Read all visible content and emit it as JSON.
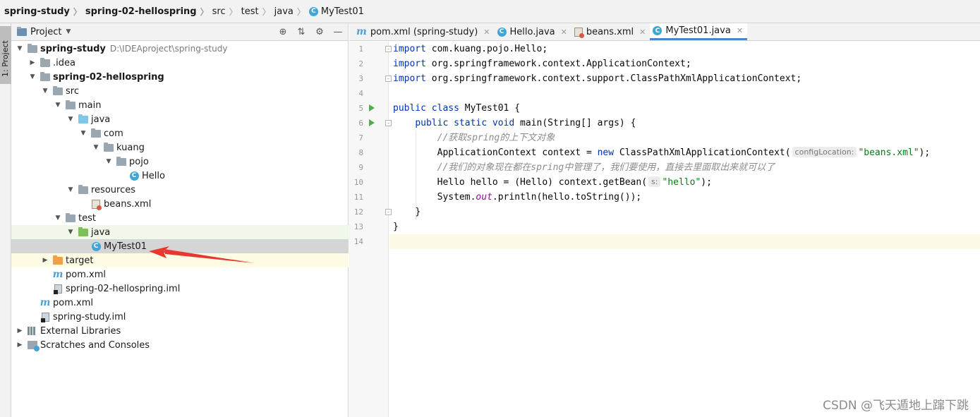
{
  "breadcrumb": [
    "spring-study",
    "spring-02-hellospring",
    "src",
    "test",
    "java",
    "MyTest01"
  ],
  "tool_strip": {
    "project_tab": "1: Project"
  },
  "project_panel": {
    "title": "Project",
    "tree": [
      {
        "label": "spring-study",
        "path": "D:\\IDEAproject\\spring-study",
        "bold": true
      },
      {
        "label": ".idea"
      },
      {
        "label": "spring-02-hellospring",
        "bold": true
      },
      {
        "label": "src"
      },
      {
        "label": "main"
      },
      {
        "label": "java"
      },
      {
        "label": "com"
      },
      {
        "label": "kuang"
      },
      {
        "label": "pojo"
      },
      {
        "label": "Hello"
      },
      {
        "label": "resources"
      },
      {
        "label": "beans.xml"
      },
      {
        "label": "test"
      },
      {
        "label": "java"
      },
      {
        "label": "MyTest01"
      },
      {
        "label": "target"
      },
      {
        "label": "pom.xml"
      },
      {
        "label": "spring-02-hellospring.iml"
      },
      {
        "label": "pom.xml"
      },
      {
        "label": "spring-study.iml"
      },
      {
        "label": "External Libraries"
      },
      {
        "label": "Scratches and Consoles"
      }
    ]
  },
  "editor": {
    "tabs": [
      {
        "label": "pom.xml (spring-study)",
        "icon": "maven-icon"
      },
      {
        "label": "Hello.java",
        "icon": "class-icon"
      },
      {
        "label": "beans.xml",
        "icon": "xml-icon"
      },
      {
        "label": "MyTest01.java",
        "icon": "class-icon",
        "active": true
      }
    ],
    "line_numbers": [
      "1",
      "2",
      "3",
      "4",
      "5",
      "6",
      "7",
      "8",
      "9",
      "10",
      "11",
      "12",
      "13",
      "14"
    ],
    "code": {
      "l1_kw": "import",
      "l1_rest": " com.kuang.pojo.Hello;",
      "l2_kw": "import",
      "l2_rest": " org.springframework.context.ApplicationContext;",
      "l3_kw": "import",
      "l3_rest": " org.springframework.context.support.ClassPathXmlApplicationContext;",
      "l5_kw": "public class",
      "l5_rest": " MyTest01 {",
      "l6_kw": "public static void",
      "l6_rest": " main(String[] args) {",
      "l7_cmt": "//获取spring的上下文对象",
      "l8_a": "ApplicationContext context = ",
      "l8_kw": "new",
      "l8_b": " ClassPathXmlApplicationContext(",
      "l8_hint": "configLocation:",
      "l8_str": "\"beans.xml\"",
      "l8_c": ");",
      "l9_cmt": "//我们的对象现在都在spring中管理了，我们要使用，直接去里面取出来就可以了",
      "l10_a": "Hello hello = (Hello) context.getBean(",
      "l10_hint": "s:",
      "l10_str": "\"hello\"",
      "l10_c": ");",
      "l11_a": "System.",
      "l11_fld": "out",
      "l11_b": ".println(hello.toString());",
      "l12": "}",
      "l13": "}"
    }
  },
  "watermark": "CSDN @飞天遁地上蹿下跳",
  "colors": {
    "keyword": "#0033b3",
    "string": "#067d17",
    "comment": "#8c8c8c",
    "annotation_arrow": "#e8372c"
  }
}
